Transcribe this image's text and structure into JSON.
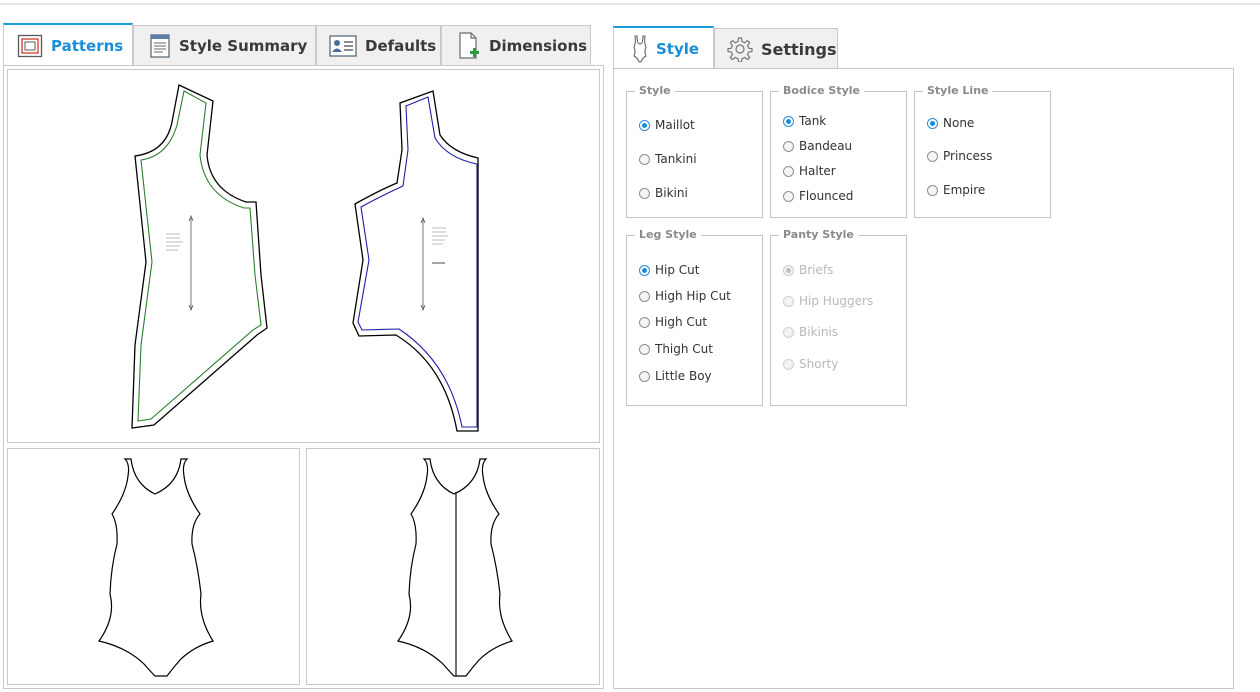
{
  "left_tabs": [
    {
      "label": "Patterns",
      "icon": "patterns-icon",
      "active": true
    },
    {
      "label": "Style Summary",
      "icon": "style-summary-icon",
      "active": false
    },
    {
      "label": "Defaults",
      "icon": "defaults-icon",
      "active": false
    },
    {
      "label": "Dimensions",
      "icon": "dimensions-icon",
      "active": false
    }
  ],
  "right_tabs": [
    {
      "label": "Style",
      "icon": "swimsuit-icon",
      "active": true
    },
    {
      "label": "Settings",
      "icon": "gear-icon",
      "active": false
    }
  ],
  "groups": {
    "style": {
      "title": "Style",
      "options": [
        "Maillot",
        "Tankini",
        "Bikini"
      ],
      "selected": "Maillot"
    },
    "bodice_style": {
      "title": "Bodice Style",
      "options": [
        "Tank",
        "Bandeau",
        "Halter",
        "Flounced"
      ],
      "selected": "Tank"
    },
    "style_line": {
      "title": "Style Line",
      "options": [
        "None",
        "Princess",
        "Empire"
      ],
      "selected": "None"
    },
    "leg_style": {
      "title": "Leg Style",
      "options": [
        "Hip Cut",
        "High Hip Cut",
        "High Cut",
        "Thigh Cut",
        "Little Boy"
      ],
      "selected": "Hip Cut"
    },
    "panty_style": {
      "title": "Panty Style",
      "options": [
        "Briefs",
        "Hip Huggers",
        "Bikinis",
        "Shorty"
      ],
      "selected": "Briefs",
      "disabled": true
    }
  },
  "colors": {
    "accent": "#1a8ed6",
    "front_seam": "#2e7d2e",
    "back_seam": "#1f1fa8"
  }
}
